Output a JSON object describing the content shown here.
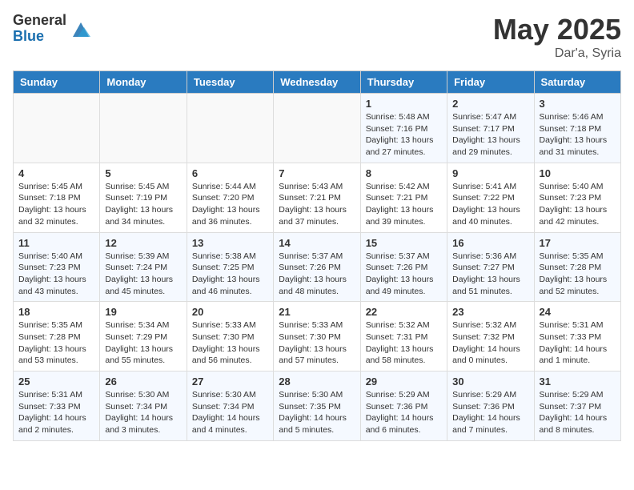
{
  "header": {
    "logo_general": "General",
    "logo_blue": "Blue",
    "month_title": "May 2025",
    "location": "Dar'a, Syria"
  },
  "weekdays": [
    "Sunday",
    "Monday",
    "Tuesday",
    "Wednesday",
    "Thursday",
    "Friday",
    "Saturday"
  ],
  "weeks": [
    [
      {
        "day": "",
        "info": ""
      },
      {
        "day": "",
        "info": ""
      },
      {
        "day": "",
        "info": ""
      },
      {
        "day": "",
        "info": ""
      },
      {
        "day": "1",
        "info": "Sunrise: 5:48 AM\nSunset: 7:16 PM\nDaylight: 13 hours\nand 27 minutes."
      },
      {
        "day": "2",
        "info": "Sunrise: 5:47 AM\nSunset: 7:17 PM\nDaylight: 13 hours\nand 29 minutes."
      },
      {
        "day": "3",
        "info": "Sunrise: 5:46 AM\nSunset: 7:18 PM\nDaylight: 13 hours\nand 31 minutes."
      }
    ],
    [
      {
        "day": "4",
        "info": "Sunrise: 5:45 AM\nSunset: 7:18 PM\nDaylight: 13 hours\nand 32 minutes."
      },
      {
        "day": "5",
        "info": "Sunrise: 5:45 AM\nSunset: 7:19 PM\nDaylight: 13 hours\nand 34 minutes."
      },
      {
        "day": "6",
        "info": "Sunrise: 5:44 AM\nSunset: 7:20 PM\nDaylight: 13 hours\nand 36 minutes."
      },
      {
        "day": "7",
        "info": "Sunrise: 5:43 AM\nSunset: 7:21 PM\nDaylight: 13 hours\nand 37 minutes."
      },
      {
        "day": "8",
        "info": "Sunrise: 5:42 AM\nSunset: 7:21 PM\nDaylight: 13 hours\nand 39 minutes."
      },
      {
        "day": "9",
        "info": "Sunrise: 5:41 AM\nSunset: 7:22 PM\nDaylight: 13 hours\nand 40 minutes."
      },
      {
        "day": "10",
        "info": "Sunrise: 5:40 AM\nSunset: 7:23 PM\nDaylight: 13 hours\nand 42 minutes."
      }
    ],
    [
      {
        "day": "11",
        "info": "Sunrise: 5:40 AM\nSunset: 7:23 PM\nDaylight: 13 hours\nand 43 minutes."
      },
      {
        "day": "12",
        "info": "Sunrise: 5:39 AM\nSunset: 7:24 PM\nDaylight: 13 hours\nand 45 minutes."
      },
      {
        "day": "13",
        "info": "Sunrise: 5:38 AM\nSunset: 7:25 PM\nDaylight: 13 hours\nand 46 minutes."
      },
      {
        "day": "14",
        "info": "Sunrise: 5:37 AM\nSunset: 7:26 PM\nDaylight: 13 hours\nand 48 minutes."
      },
      {
        "day": "15",
        "info": "Sunrise: 5:37 AM\nSunset: 7:26 PM\nDaylight: 13 hours\nand 49 minutes."
      },
      {
        "day": "16",
        "info": "Sunrise: 5:36 AM\nSunset: 7:27 PM\nDaylight: 13 hours\nand 51 minutes."
      },
      {
        "day": "17",
        "info": "Sunrise: 5:35 AM\nSunset: 7:28 PM\nDaylight: 13 hours\nand 52 minutes."
      }
    ],
    [
      {
        "day": "18",
        "info": "Sunrise: 5:35 AM\nSunset: 7:28 PM\nDaylight: 13 hours\nand 53 minutes."
      },
      {
        "day": "19",
        "info": "Sunrise: 5:34 AM\nSunset: 7:29 PM\nDaylight: 13 hours\nand 55 minutes."
      },
      {
        "day": "20",
        "info": "Sunrise: 5:33 AM\nSunset: 7:30 PM\nDaylight: 13 hours\nand 56 minutes."
      },
      {
        "day": "21",
        "info": "Sunrise: 5:33 AM\nSunset: 7:30 PM\nDaylight: 13 hours\nand 57 minutes."
      },
      {
        "day": "22",
        "info": "Sunrise: 5:32 AM\nSunset: 7:31 PM\nDaylight: 13 hours\nand 58 minutes."
      },
      {
        "day": "23",
        "info": "Sunrise: 5:32 AM\nSunset: 7:32 PM\nDaylight: 14 hours\nand 0 minutes."
      },
      {
        "day": "24",
        "info": "Sunrise: 5:31 AM\nSunset: 7:33 PM\nDaylight: 14 hours\nand 1 minute."
      }
    ],
    [
      {
        "day": "25",
        "info": "Sunrise: 5:31 AM\nSunset: 7:33 PM\nDaylight: 14 hours\nand 2 minutes."
      },
      {
        "day": "26",
        "info": "Sunrise: 5:30 AM\nSunset: 7:34 PM\nDaylight: 14 hours\nand 3 minutes."
      },
      {
        "day": "27",
        "info": "Sunrise: 5:30 AM\nSunset: 7:34 PM\nDaylight: 14 hours\nand 4 minutes."
      },
      {
        "day": "28",
        "info": "Sunrise: 5:30 AM\nSunset: 7:35 PM\nDaylight: 14 hours\nand 5 minutes."
      },
      {
        "day": "29",
        "info": "Sunrise: 5:29 AM\nSunset: 7:36 PM\nDaylight: 14 hours\nand 6 minutes."
      },
      {
        "day": "30",
        "info": "Sunrise: 5:29 AM\nSunset: 7:36 PM\nDaylight: 14 hours\nand 7 minutes."
      },
      {
        "day": "31",
        "info": "Sunrise: 5:29 AM\nSunset: 7:37 PM\nDaylight: 14 hours\nand 8 minutes."
      }
    ]
  ]
}
